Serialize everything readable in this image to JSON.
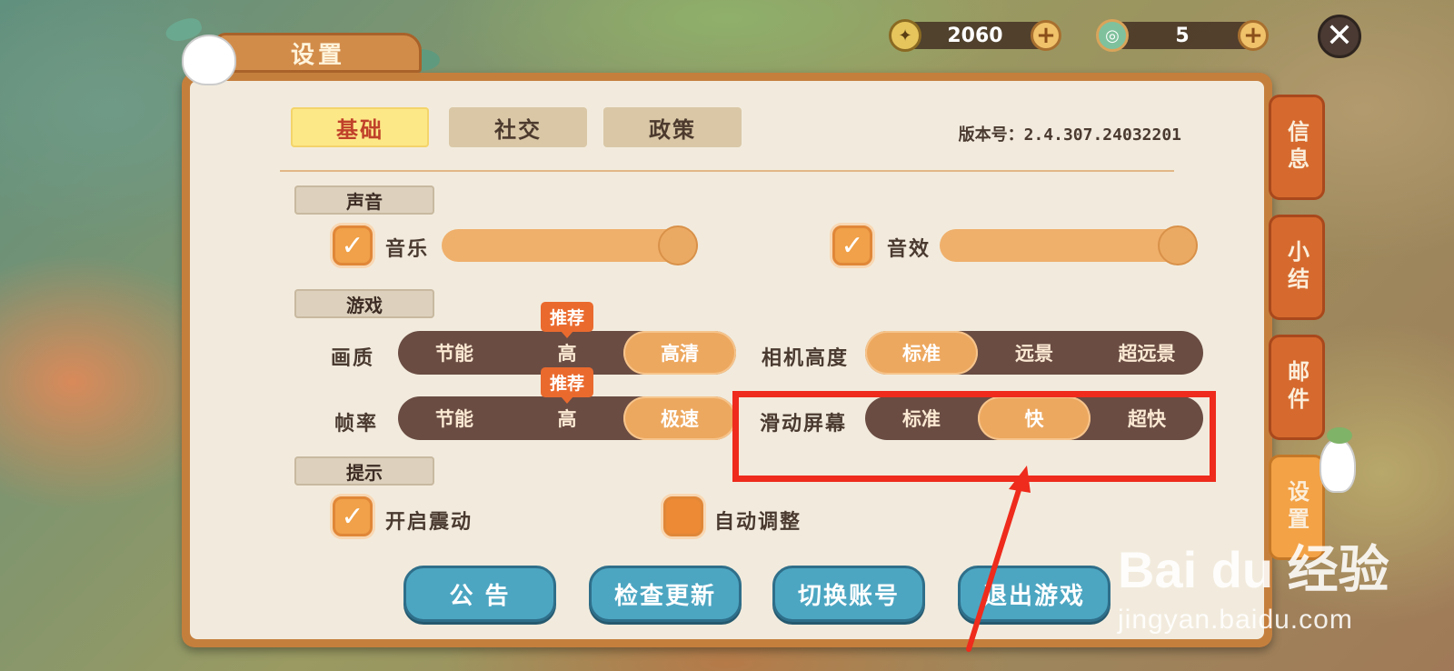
{
  "header": {
    "title": "设置",
    "currency_gold": {
      "value": "2060",
      "icon": "gold-coin-icon"
    },
    "currency_gem": {
      "value": "5",
      "icon": "jade-coin-icon"
    },
    "plus": "+",
    "close": "✕"
  },
  "tabs": [
    "基础",
    "社交",
    "政策"
  ],
  "version": "版本号：2.4.307.24032201",
  "sections": {
    "sound": "声音",
    "game": "游戏",
    "hint": "提示"
  },
  "sound": {
    "music_label": "音乐",
    "music_checked": true,
    "music_level": 1.0,
    "sfx_label": "音效",
    "sfx_checked": true,
    "sfx_level": 1.0
  },
  "game": {
    "quality": {
      "label": "画质",
      "options": [
        "节能",
        "高",
        "高清"
      ],
      "selected": 2,
      "recommend": "推荐"
    },
    "camera": {
      "label": "相机高度",
      "options": [
        "标准",
        "远景",
        "超远景"
      ],
      "selected": 0
    },
    "framerate": {
      "label": "帧率",
      "options": [
        "节能",
        "高",
        "极速"
      ],
      "selected": 2,
      "recommend": "推荐"
    },
    "scroll": {
      "label": "滑动屏幕",
      "options": [
        "标准",
        "快",
        "超快"
      ],
      "selected": 1
    }
  },
  "hint": {
    "vibrate_label": "开启震动",
    "vibrate_checked": true,
    "auto_label": "自动调整",
    "auto_checked": false
  },
  "buttons": [
    "公 告",
    "检查更新",
    "切换账号",
    "退出游戏"
  ],
  "side_tabs": [
    "信息",
    "小结",
    "邮件",
    "设置"
  ],
  "check_mark": "✓",
  "watermark": {
    "brand": "Bai du 经验",
    "url": "jingyan.baidu.com"
  },
  "colors": {
    "accent": "#eda85f",
    "highlight": "#ee2b1c",
    "button": "#4ca6c2",
    "panel": "#f2ebdd"
  }
}
